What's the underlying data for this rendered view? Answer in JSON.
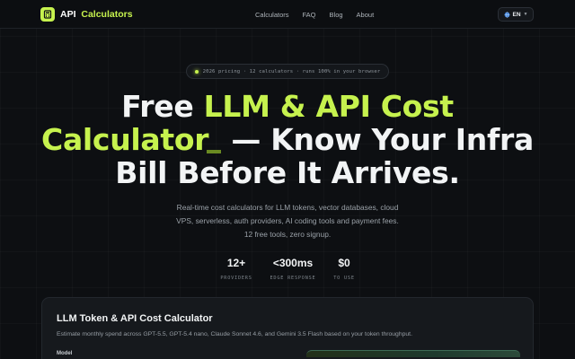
{
  "colors": {
    "accent": "#c6f24e",
    "background": "#0d0f12",
    "card": "#16191d"
  },
  "nav": {
    "logo_icon": "calculator-icon",
    "brand_first": "API",
    "brand_second": "Calculators",
    "links": [
      "Calculators",
      "FAQ",
      "Blog",
      "About"
    ],
    "lang_icon": "globe-icon",
    "lang": "EN"
  },
  "badge": {
    "text": "2026 pricing · 12 calculators · runs 100% in your browser"
  },
  "hero": {
    "part1": "Free ",
    "highlight1": "LLM & API Cost",
    "highlight2": "Calculator",
    "part2": " — Know Your Infra",
    "part3": "Bill Before It Arrives."
  },
  "subtitle": {
    "line1": "Real-time cost calculators for LLM tokens, vector databases, cloud",
    "line2": "VPS, serverless, auth providers, AI coding tools and payment fees.",
    "line3": "12 free tools, zero signup."
  },
  "stats": [
    {
      "value": "12+",
      "label": "PROVIDERS"
    },
    {
      "value": "<300ms",
      "label": "EDGE RESPONSE"
    },
    {
      "value": "$0",
      "label": "TO USE"
    }
  ],
  "card": {
    "title": "LLM Token & API Cost Calculator",
    "description": "Estimate monthly spend across GPT-5.5, GPT-5.4 nano, Claude Sonnet 4.6, and Gemini 3.5 Flash based on your token throughput.",
    "model_label": "Model"
  }
}
